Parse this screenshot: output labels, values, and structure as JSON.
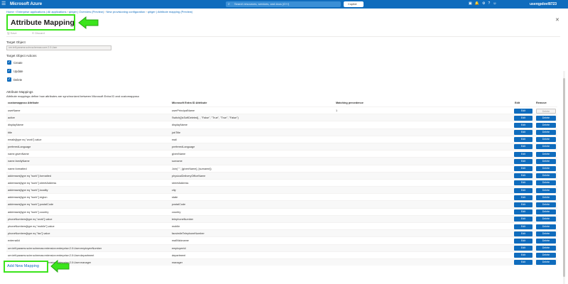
{
  "topbar": {
    "brand": "Microsoft Azure",
    "search_placeholder": "Search resources, services, and docs (G+/)",
    "copilot_label": "Copilot",
    "user": "userqpdovl8723"
  },
  "breadcrumb": [
    "Home",
    "Enterprise applications | All applications",
    "qiriger | Overview (Preview)",
    "New provisioning configuration",
    "qiriger | Attribute mapping (Preview)"
  ],
  "page": {
    "title": "Attribute Mapping",
    "save_label": "Save",
    "discard_label": "Discard",
    "target_object_label": "Target Object",
    "target_object_value": "urn:ietf:params:scim:schemas:core:2.0:User",
    "target_actions_label": "Target Object Actions",
    "actions": [
      {
        "label": "Create",
        "checked": true
      },
      {
        "label": "Update",
        "checked": true
      },
      {
        "label": "Delete",
        "checked": true
      }
    ],
    "mappings_title": "Attribute Mappings",
    "mappings_desc": "Attribute mappings define how attributes are synchronized between Microsoft Entra ID and customappsso"
  },
  "table": {
    "headers": {
      "target": "customappsso Attribute",
      "source": "Microsoft Entra ID Attribute",
      "precedence": "Matching precedence",
      "edit": "Edit",
      "remove": "Remove"
    },
    "edit_label": "Edit",
    "delete_label": "Delete",
    "rows": [
      {
        "target": "userName",
        "source": "userPrincipalName",
        "precedence": "1",
        "delete_disabled": true
      },
      {
        "target": "active",
        "source": "Switch([IsSoftDeleted], , \"False\", \"True\", \"True\", \"False\")",
        "precedence": ""
      },
      {
        "target": "displayName",
        "source": "displayName",
        "precedence": ""
      },
      {
        "target": "title",
        "source": "jobTitle",
        "precedence": ""
      },
      {
        "target": "emails[type eq \"work\"].value",
        "source": "mail",
        "precedence": ""
      },
      {
        "target": "preferredLanguage",
        "source": "preferredLanguage",
        "precedence": ""
      },
      {
        "target": "name.givenName",
        "source": "givenName",
        "precedence": ""
      },
      {
        "target": "name.familyName",
        "source": "surname",
        "precedence": ""
      },
      {
        "target": "name.formatted",
        "source": "Join(\" \", [givenName], [surname])",
        "precedence": ""
      },
      {
        "target": "addresses[type eq \"work\"].formatted",
        "source": "physicalDeliveryOfficeName",
        "precedence": ""
      },
      {
        "target": "addresses[type eq \"work\"].streetAddress",
        "source": "streetAddress",
        "precedence": ""
      },
      {
        "target": "addresses[type eq \"work\"].locality",
        "source": "city",
        "precedence": ""
      },
      {
        "target": "addresses[type eq \"work\"].region",
        "source": "state",
        "precedence": ""
      },
      {
        "target": "addresses[type eq \"work\"].postalCode",
        "source": "postalCode",
        "precedence": ""
      },
      {
        "target": "addresses[type eq \"work\"].country",
        "source": "country",
        "precedence": ""
      },
      {
        "target": "phoneNumbers[type eq \"work\"].value",
        "source": "telephoneNumber",
        "precedence": ""
      },
      {
        "target": "phoneNumbers[type eq \"mobile\"].value",
        "source": "mobile",
        "precedence": ""
      },
      {
        "target": "phoneNumbers[type eq \"fax\"].value",
        "source": "facsimileTelephoneNumber",
        "precedence": ""
      },
      {
        "target": "externalId",
        "source": "mailNickname",
        "precedence": ""
      },
      {
        "target": "urn:ietf:params:scim:schemas:extension:enterprise:2.0:User:employeeNumber",
        "source": "employeeId",
        "precedence": ""
      },
      {
        "target": "urn:ietf:params:scim:schemas:extension:enterprise:2.0:User:department",
        "source": "department",
        "precedence": ""
      },
      {
        "target": "urn:ietf:params:scim:schemas:extension:enterprise:2.0:User:manager",
        "source": "manager",
        "precedence": ""
      }
    ]
  },
  "add_mapping_label": "Add New Mapping",
  "colors": {
    "accent": "#0f6cbd",
    "highlight": "#3be41c"
  }
}
